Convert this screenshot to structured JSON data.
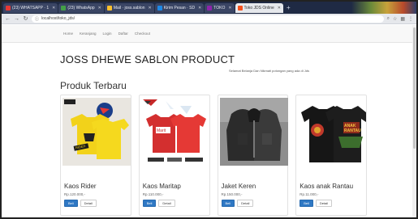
{
  "browser": {
    "tabs": [
      {
        "label": "(23) WHATSAPP · 1",
        "color": "#e53935",
        "active": false
      },
      {
        "label": "(23) WhatsApp",
        "color": "#43a047",
        "active": false
      },
      {
        "label": "Mail · joss.sablon",
        "color": "#fbc02d",
        "active": false
      },
      {
        "label": "Kirim Pesan · SD",
        "color": "#1e88e5",
        "active": false
      },
      {
        "label": "TOKO",
        "color": "#8e24aa",
        "active": false
      },
      {
        "label": "Toko JDS Online",
        "color": "#f4511e",
        "active": true
      }
    ],
    "url": "localhost/toko_jds/",
    "icons": {
      "back": "back-arrow-icon",
      "forward": "forward-arrow-icon",
      "reload": "reload-icon",
      "secure": "info-icon",
      "star": "star-icon",
      "menu": "menu-icon"
    }
  },
  "navbar": {
    "links": [
      "Home",
      "Keranjang",
      "Login",
      "Daftar",
      "Checkout"
    ]
  },
  "jumbotron": {
    "title": "JOSS DHEWE SABLON PRODUCT",
    "tagline": "Selamat Belanja Dan Nikmati potongan yang ada di Jds"
  },
  "section": {
    "title": "Produk Terbaru"
  },
  "products": [
    {
      "name": "Kaos Rider",
      "price": "Rp.120.000,-",
      "buy_label": "Beli",
      "detail_label": "Detail",
      "image": "yellow-tshirt-image"
    },
    {
      "name": "Kaos Maritap",
      "price": "Rp.110.000,-",
      "buy_label": "Beli",
      "detail_label": "Detail",
      "image": "red-tshirt-image"
    },
    {
      "name": "Jaket Keren",
      "price": "Rp.150.000,-",
      "buy_label": "Beli",
      "detail_label": "Detail",
      "image": "black-jacket-image"
    },
    {
      "name": "Kaos anak Rantau",
      "price": "Rp.11.000,-",
      "buy_label": "Beli",
      "detail_label": "Detail",
      "image": "black-tshirt-image"
    }
  ],
  "colors": {
    "primary_button": "#2f78c4",
    "tabstrip": "#1f2a44"
  }
}
